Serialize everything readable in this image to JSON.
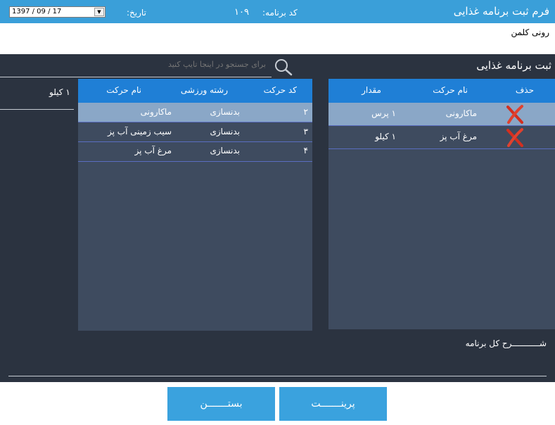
{
  "header": {
    "title": "فرم ثبت برنامه  غذایی",
    "code_label": "کد برنامه:",
    "code_value": "۱۰۹",
    "date_label": "تاریخ:",
    "date_value": "1397 / 09 / 17"
  },
  "user": {
    "name": "رونی کلمن"
  },
  "section": {
    "title": "ثبت برنامه غذایی"
  },
  "search": {
    "placeholder": "برای جستجو در اینجا تایپ کنید"
  },
  "left_column": {
    "value": "۱ کیلو"
  },
  "exercise_table": {
    "headers": {
      "code": "کد حرکت",
      "field": "رشته ورزشی",
      "name": "نام حرکت"
    },
    "rows": [
      {
        "code": "۲",
        "field": "بدنسازی",
        "name": "ماکارونی",
        "selected": true
      },
      {
        "code": "۳",
        "field": "بدنسازی",
        "name": "سیب زمینی آب پز",
        "selected": false
      },
      {
        "code": "۴",
        "field": "بدنسازی",
        "name": "مرغ آب پز",
        "selected": false
      }
    ]
  },
  "diet_table": {
    "headers": {
      "delete": "حذف",
      "name": "نام حرکت",
      "amount": "مقدار"
    },
    "rows": [
      {
        "name": "ماکارونی",
        "amount": "۱ پرس",
        "icon": "delete-x-icon",
        "selected": true
      },
      {
        "name": "مرغ آب پز",
        "amount": "۱ کیلو",
        "icon": "delete-x-icon",
        "selected": false
      }
    ]
  },
  "description": {
    "label": "شـــــــــــرح کل برنامه"
  },
  "buttons": {
    "print": "پرینـــــــت",
    "close": "بستـــــــن"
  },
  "colors": {
    "title_bar": "#3a9fd9",
    "dark_bg": "#2b3340",
    "panel_bg": "#3e4b5f",
    "table_header": "#1f7fd6",
    "selected_row": "#8aa7c7",
    "button": "#3aa2de"
  }
}
